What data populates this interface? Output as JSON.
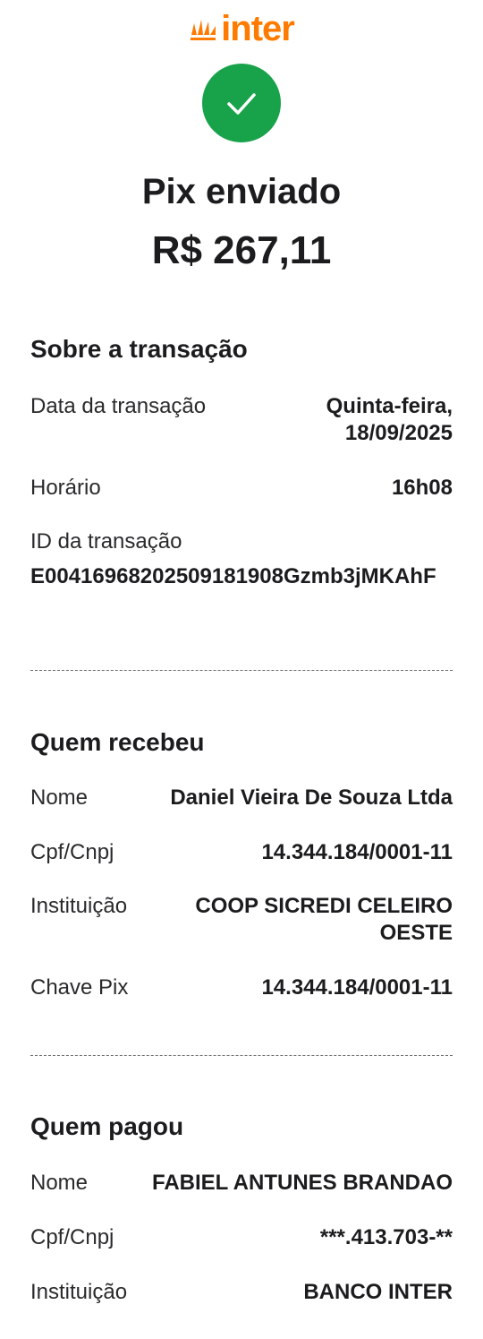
{
  "brand": {
    "name": "inter",
    "color": "#ff7a00",
    "icon": "inter-logo-icon"
  },
  "status": {
    "icon": "check-icon",
    "color": "#18a34a",
    "title": "Pix enviado",
    "amount": "R$ 267,11"
  },
  "transaction": {
    "section_title": "Sobre a transação",
    "date_label": "Data da transação",
    "date_value_line1": "Quinta-feira,",
    "date_value_line2": "18/09/2025",
    "time_label": "Horário",
    "time_value": "16h08",
    "id_label": "ID da transação",
    "id_value": "E00416968202509181908Gzmb3jMKAhF"
  },
  "receiver": {
    "section_title": "Quem recebeu",
    "name_label": "Nome",
    "name_value": "Daniel Vieira De Souza Ltda",
    "doc_label": "Cpf/Cnpj",
    "doc_value": "14.344.184/0001-11",
    "institution_label": "Instituição",
    "institution_value_line1": "COOP SICREDI CELEIRO",
    "institution_value_line2": "OESTE",
    "pix_key_label": "Chave Pix",
    "pix_key_value": "14.344.184/0001-11"
  },
  "payer": {
    "section_title": "Quem pagou",
    "name_label": "Nome",
    "name_value": "FABIEL ANTUNES BRANDAO",
    "doc_label": "Cpf/Cnpj",
    "doc_value": "***.413.703-**",
    "institution_label": "Instituição",
    "institution_value": "BANCO INTER"
  }
}
